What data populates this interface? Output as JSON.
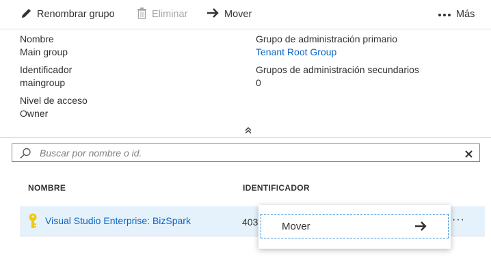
{
  "toolbar": {
    "rename_label": "Renombrar grupo",
    "delete_label": "Eliminar",
    "move_label": "Mover",
    "more_label": "Más"
  },
  "details": {
    "name_label": "Nombre",
    "name_value": "Main group",
    "id_label": "Identificador",
    "id_value": "maingroup",
    "access_label": "Nivel de acceso",
    "access_value": "Owner",
    "parent_label": "Grupo de administración primario",
    "parent_value": "Tenant Root Group",
    "children_label": "Grupos de administración secundarios",
    "children_value": "0"
  },
  "search": {
    "placeholder": "Buscar por nombre o id."
  },
  "table": {
    "columns": [
      "NOMBRE",
      "IDENTIFICADOR"
    ],
    "rows": [
      {
        "name": "Visual Studio Enterprise: BizSpark",
        "id": "403"
      }
    ]
  },
  "context_menu": {
    "items": [
      "Mover"
    ]
  },
  "colors": {
    "accent": "#0a64c8",
    "row_selected": "#e6f2fb",
    "key_icon": "#f2c811"
  },
  "icons": [
    "pencil-icon",
    "trash-icon",
    "arrow-right-icon",
    "ellipsis-icon",
    "chevron-double-up-icon",
    "search-icon",
    "close-icon",
    "key-icon"
  ]
}
